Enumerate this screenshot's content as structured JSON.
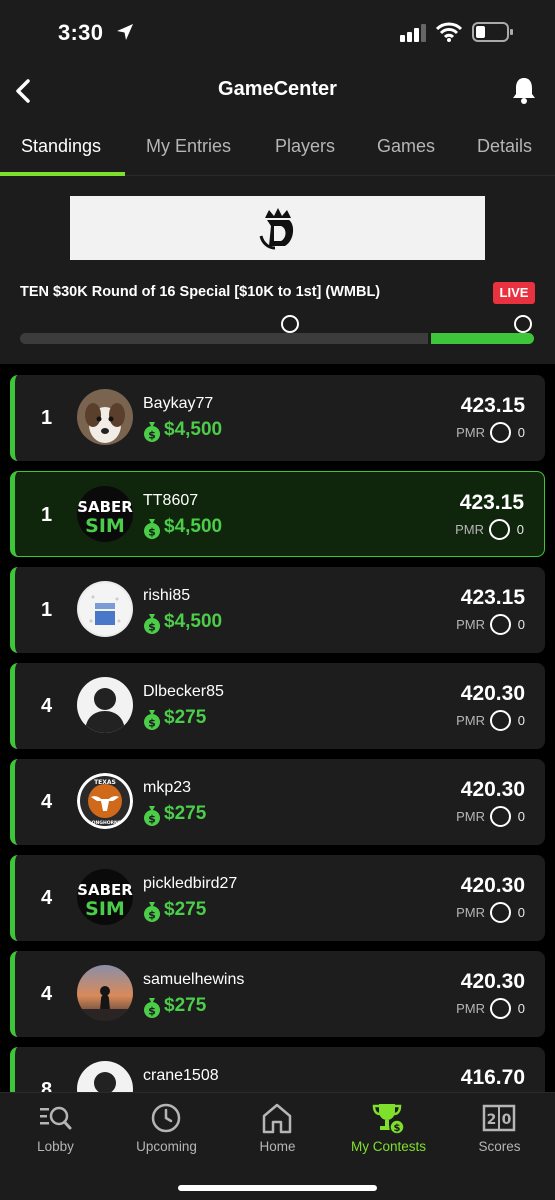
{
  "status_bar": {
    "time": "3:30"
  },
  "header": {
    "title": "GameCenter",
    "back_icon": "chevron-left-icon",
    "bell_icon": "bell-icon"
  },
  "tabs": [
    {
      "label": "Standings",
      "active": true
    },
    {
      "label": "My Entries",
      "active": false
    },
    {
      "label": "Players",
      "active": false
    },
    {
      "label": "Games",
      "active": false
    },
    {
      "label": "Details",
      "active": false
    }
  ],
  "contest": {
    "name": "TEN $30K Round of 16 Special [$10K to 1st] (WMBL)",
    "status_badge": "LIVE",
    "banner_logo": "draftkings-crown-logo",
    "progress": 0.2
  },
  "standings": [
    {
      "rank": "1",
      "username": "Baykay77",
      "prize": "$4,500",
      "score": "423.15",
      "pmr_label": "PMR",
      "pmr_value": "0",
      "avatar": "dog-photo",
      "highlight": false
    },
    {
      "rank": "1",
      "username": "TT8607",
      "prize": "$4,500",
      "score": "423.15",
      "pmr_label": "PMR",
      "pmr_value": "0",
      "avatar": "sabersim-logo",
      "avatar_text_top": "SABER",
      "avatar_text_bottom": "SIM",
      "highlight": true
    },
    {
      "rank": "1",
      "username": "rishi85",
      "prize": "$4,500",
      "score": "423.15",
      "pmr_label": "PMR",
      "pmr_value": "0",
      "avatar": "golf-ball-photo",
      "highlight": false
    },
    {
      "rank": "4",
      "username": "Dlbecker85",
      "prize": "$275",
      "score": "420.30",
      "pmr_label": "PMR",
      "pmr_value": "0",
      "avatar": "default-person",
      "highlight": false
    },
    {
      "rank": "4",
      "username": "mkp23",
      "prize": "$275",
      "score": "420.30",
      "pmr_label": "PMR",
      "pmr_value": "0",
      "avatar": "longhorns-logo",
      "avatar_text_top": "TEXAS",
      "avatar_text_bottom": "LONGHORNS",
      "highlight": false
    },
    {
      "rank": "4",
      "username": "pickledbird27",
      "prize": "$275",
      "score": "420.30",
      "pmr_label": "PMR",
      "pmr_value": "0",
      "avatar": "sabersim-logo",
      "avatar_text_top": "SABER",
      "avatar_text_bottom": "SIM",
      "highlight": false
    },
    {
      "rank": "4",
      "username": "samuelhewins",
      "prize": "$275",
      "score": "420.30",
      "pmr_label": "PMR",
      "pmr_value": "0",
      "avatar": "sunset-photo",
      "highlight": false
    },
    {
      "rank": "8",
      "username": "crane1508",
      "prize": "",
      "score": "416.70",
      "pmr_label": "PMR",
      "pmr_value": "0",
      "avatar": "default-person",
      "highlight": false
    }
  ],
  "bottom_nav": [
    {
      "label": "Lobby",
      "icon": "search-list-icon",
      "active": false
    },
    {
      "label": "Upcoming",
      "icon": "clock-icon",
      "active": false
    },
    {
      "label": "Home",
      "icon": "home-icon",
      "active": false
    },
    {
      "label": "My Contests",
      "icon": "trophy-icon",
      "active": true
    },
    {
      "label": "Scores",
      "icon": "scoreboard-icon",
      "active": false
    }
  ],
  "colors": {
    "accent_green": "#3ec63a",
    "tab_underline": "#7ee02c",
    "live_red": "#e8323f",
    "prize_green": "#4ccd4a"
  }
}
